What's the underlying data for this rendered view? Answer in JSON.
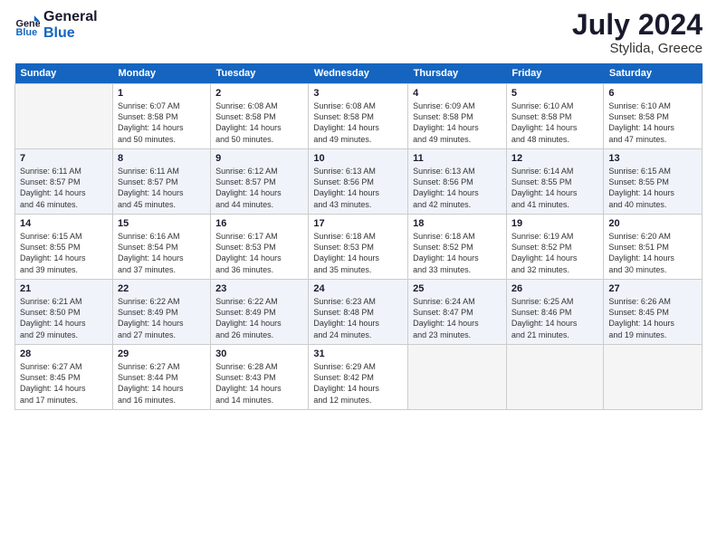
{
  "logo": {
    "text_general": "General",
    "text_blue": "Blue"
  },
  "header": {
    "month_year": "July 2024",
    "location": "Stylida, Greece"
  },
  "days_of_week": [
    "Sunday",
    "Monday",
    "Tuesday",
    "Wednesday",
    "Thursday",
    "Friday",
    "Saturday"
  ],
  "weeks": [
    [
      {
        "day": "",
        "empty": true
      },
      {
        "day": "1",
        "sunrise": "6:07 AM",
        "sunset": "8:58 PM",
        "daylight": "14 hours and 50 minutes."
      },
      {
        "day": "2",
        "sunrise": "6:08 AM",
        "sunset": "8:58 PM",
        "daylight": "14 hours and 50 minutes."
      },
      {
        "day": "3",
        "sunrise": "6:08 AM",
        "sunset": "8:58 PM",
        "daylight": "14 hours and 49 minutes."
      },
      {
        "day": "4",
        "sunrise": "6:09 AM",
        "sunset": "8:58 PM",
        "daylight": "14 hours and 49 minutes."
      },
      {
        "day": "5",
        "sunrise": "6:10 AM",
        "sunset": "8:58 PM",
        "daylight": "14 hours and 48 minutes."
      },
      {
        "day": "6",
        "sunrise": "6:10 AM",
        "sunset": "8:58 PM",
        "daylight": "14 hours and 47 minutes."
      }
    ],
    [
      {
        "day": "7",
        "sunrise": "6:11 AM",
        "sunset": "8:57 PM",
        "daylight": "14 hours and 46 minutes."
      },
      {
        "day": "8",
        "sunrise": "6:11 AM",
        "sunset": "8:57 PM",
        "daylight": "14 hours and 45 minutes."
      },
      {
        "day": "9",
        "sunrise": "6:12 AM",
        "sunset": "8:57 PM",
        "daylight": "14 hours and 44 minutes."
      },
      {
        "day": "10",
        "sunrise": "6:13 AM",
        "sunset": "8:56 PM",
        "daylight": "14 hours and 43 minutes."
      },
      {
        "day": "11",
        "sunrise": "6:13 AM",
        "sunset": "8:56 PM",
        "daylight": "14 hours and 42 minutes."
      },
      {
        "day": "12",
        "sunrise": "6:14 AM",
        "sunset": "8:55 PM",
        "daylight": "14 hours and 41 minutes."
      },
      {
        "day": "13",
        "sunrise": "6:15 AM",
        "sunset": "8:55 PM",
        "daylight": "14 hours and 40 minutes."
      }
    ],
    [
      {
        "day": "14",
        "sunrise": "6:15 AM",
        "sunset": "8:55 PM",
        "daylight": "14 hours and 39 minutes."
      },
      {
        "day": "15",
        "sunrise": "6:16 AM",
        "sunset": "8:54 PM",
        "daylight": "14 hours and 37 minutes."
      },
      {
        "day": "16",
        "sunrise": "6:17 AM",
        "sunset": "8:53 PM",
        "daylight": "14 hours and 36 minutes."
      },
      {
        "day": "17",
        "sunrise": "6:18 AM",
        "sunset": "8:53 PM",
        "daylight": "14 hours and 35 minutes."
      },
      {
        "day": "18",
        "sunrise": "6:18 AM",
        "sunset": "8:52 PM",
        "daylight": "14 hours and 33 minutes."
      },
      {
        "day": "19",
        "sunrise": "6:19 AM",
        "sunset": "8:52 PM",
        "daylight": "14 hours and 32 minutes."
      },
      {
        "day": "20",
        "sunrise": "6:20 AM",
        "sunset": "8:51 PM",
        "daylight": "14 hours and 30 minutes."
      }
    ],
    [
      {
        "day": "21",
        "sunrise": "6:21 AM",
        "sunset": "8:50 PM",
        "daylight": "14 hours and 29 minutes."
      },
      {
        "day": "22",
        "sunrise": "6:22 AM",
        "sunset": "8:49 PM",
        "daylight": "14 hours and 27 minutes."
      },
      {
        "day": "23",
        "sunrise": "6:22 AM",
        "sunset": "8:49 PM",
        "daylight": "14 hours and 26 minutes."
      },
      {
        "day": "24",
        "sunrise": "6:23 AM",
        "sunset": "8:48 PM",
        "daylight": "14 hours and 24 minutes."
      },
      {
        "day": "25",
        "sunrise": "6:24 AM",
        "sunset": "8:47 PM",
        "daylight": "14 hours and 23 minutes."
      },
      {
        "day": "26",
        "sunrise": "6:25 AM",
        "sunset": "8:46 PM",
        "daylight": "14 hours and 21 minutes."
      },
      {
        "day": "27",
        "sunrise": "6:26 AM",
        "sunset": "8:45 PM",
        "daylight": "14 hours and 19 minutes."
      }
    ],
    [
      {
        "day": "28",
        "sunrise": "6:27 AM",
        "sunset": "8:45 PM",
        "daylight": "14 hours and 17 minutes."
      },
      {
        "day": "29",
        "sunrise": "6:27 AM",
        "sunset": "8:44 PM",
        "daylight": "14 hours and 16 minutes."
      },
      {
        "day": "30",
        "sunrise": "6:28 AM",
        "sunset": "8:43 PM",
        "daylight": "14 hours and 14 minutes."
      },
      {
        "day": "31",
        "sunrise": "6:29 AM",
        "sunset": "8:42 PM",
        "daylight": "14 hours and 12 minutes."
      },
      {
        "day": "",
        "empty": true
      },
      {
        "day": "",
        "empty": true
      },
      {
        "day": "",
        "empty": true
      }
    ]
  ],
  "labels": {
    "sunrise": "Sunrise:",
    "sunset": "Sunset:",
    "daylight": "Daylight:"
  }
}
